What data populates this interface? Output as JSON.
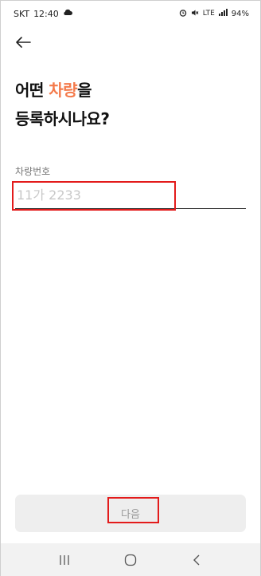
{
  "status_bar": {
    "carrier": "SKT",
    "time": "12:40",
    "network": "LTE",
    "battery": "94%",
    "icons": [
      "cloud-icon",
      "alarm-icon",
      "mute-icon",
      "lte-icon",
      "signal-icon"
    ]
  },
  "header": {
    "back_icon": "arrow-left-icon"
  },
  "heading": {
    "line1_prefix": "어떤",
    "line1_accent": "차량",
    "line1_suffix": "을",
    "line2": "등록하시나요?",
    "accent_color": "#f47a4b"
  },
  "form": {
    "label": "차량번호",
    "placeholder": "11가 2233",
    "value": ""
  },
  "actions": {
    "next_label": "다음"
  },
  "annotations": {
    "highlight_color": "#e31b1b"
  },
  "nav": {
    "recents_icon": "recent-apps-icon",
    "home_icon": "home-icon",
    "back_icon": "back-chevron-icon"
  }
}
